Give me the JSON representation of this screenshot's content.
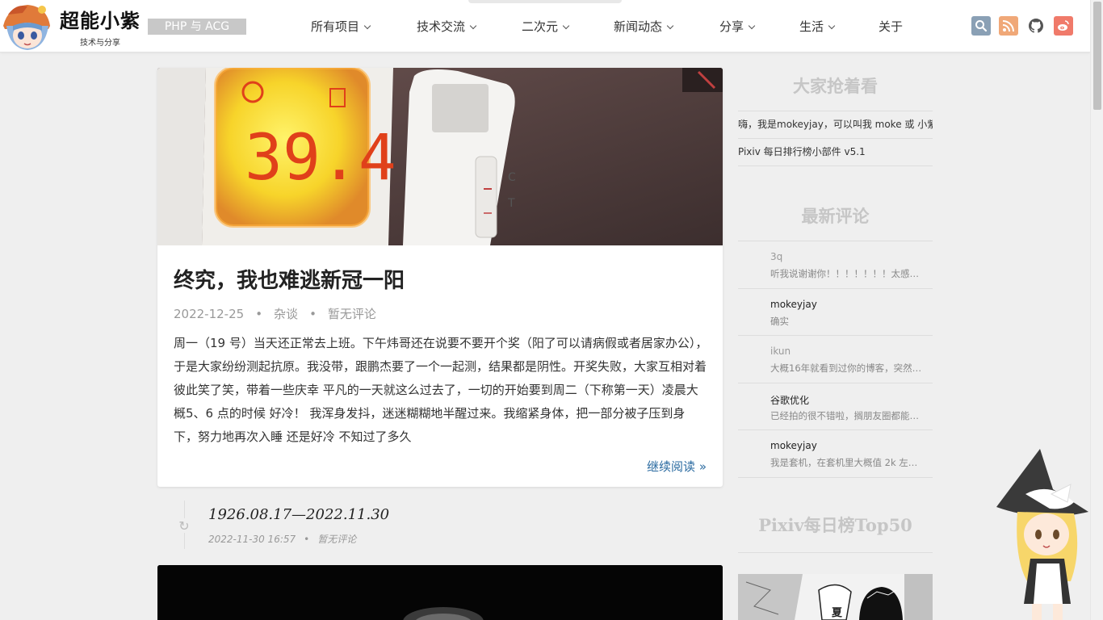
{
  "header": {
    "site_title": "超能小紫",
    "site_subtitle": "技术与分享",
    "site_tag": "PHP 与 ACG",
    "nav": [
      {
        "label": "所有项目",
        "dropdown": true
      },
      {
        "label": "技术交流",
        "dropdown": true
      },
      {
        "label": "二次元",
        "dropdown": true
      },
      {
        "label": "新闻动态",
        "dropdown": true
      },
      {
        "label": "分享",
        "dropdown": true
      },
      {
        "label": "生活",
        "dropdown": true
      },
      {
        "label": "关于",
        "dropdown": false
      }
    ],
    "icons": [
      "search-icon",
      "rss-icon",
      "github-icon",
      "weibo-icon"
    ]
  },
  "post": {
    "title": "终究，我也难逃新冠一阳",
    "date": "2022-12-25",
    "category": "杂谈",
    "comments": "暂无评论",
    "excerpt": "周一（19 号）当天还正常去上班。下午炜哥还在说要不要开个奖（阳了可以请病假或者居家办公），于是大家纷纷测起抗原。我没带，跟鹏杰要了一个一起测，结果都是阴性。开奖失败，大家互相对着彼此笑了笑，带着一些庆幸 平凡的一天就这么过去了，一切的开始要到周二（下称第一天）凌晨大概5、6 点的时候 好冷！ 我浑身发抖，迷迷糊糊地半醒过来。我缩紧身体，把一部分被子压到身下，努力地再次入睡 还是好冷 不知过了多久",
    "read_more": "继续阅读 »",
    "thermometer_reading": "39.4"
  },
  "status_post": {
    "title": "1926.08.17—2022.11.30",
    "datetime": "2022-11-30 16:57",
    "comments": "暂无评论"
  },
  "sidebar": {
    "popular_title": "大家抢着看",
    "popular": [
      "嗨，我是mokeyjay，可以叫我 moke 或 小紫",
      "Pixiv 每日排行榜小部件 v5.1"
    ],
    "comments_title": "最新评论",
    "comments": [
      {
        "name": "3q",
        "text": "听我说谢谢你！！！！！！！太感…",
        "light": true
      },
      {
        "name": "mokeyjay",
        "text": "确实",
        "light": false
      },
      {
        "name": "ikun",
        "text": "大概16年就看到过你的博客，突然…",
        "light": true
      },
      {
        "name": "谷歌优化",
        "text": "已经拍的很不错啦，搁朋友圈都能…",
        "light": false
      },
      {
        "name": "mokeyjay",
        "text": "我是套机，在套机里大概值 2k 左…",
        "light": false
      }
    ],
    "pixiv_title": "Pixiv每日榜Top50",
    "pixiv_image_text": "夏"
  },
  "colors": {
    "accent_link": "#2a6aa0",
    "widget_title": "#c6c6c6",
    "search_icon_bg": "#8aa0b5",
    "rss_icon_bg": "#f0a878",
    "weibo_icon_bg": "#f07a6a",
    "thermometer_display": "#f5d820"
  }
}
